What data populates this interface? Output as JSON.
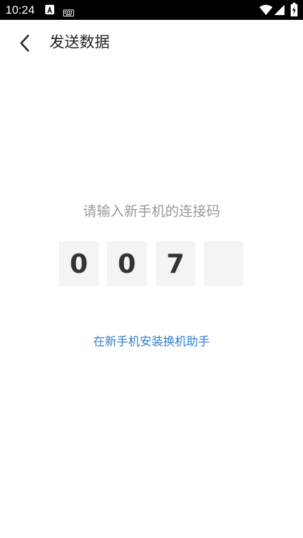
{
  "status_bar": {
    "time": "10:24",
    "icons": [
      "android-a-icon",
      "keyboard-icon",
      "wifi-icon",
      "signal-icon",
      "battery-icon"
    ]
  },
  "header": {
    "title": "发送数据",
    "back_icon": "chevron-left-icon"
  },
  "main": {
    "prompt": "请输入新手机的连接码",
    "code_digits": [
      "0",
      "0",
      "7",
      ""
    ],
    "install_link": "在新手机安装换机助手"
  },
  "colors": {
    "status_bar_bg": "#000000",
    "title_text": "#222222",
    "prompt_text": "#9a9a9a",
    "code_box_bg": "#f4f4f4",
    "code_digit_text": "#333333",
    "link": "#2f7fd0"
  }
}
